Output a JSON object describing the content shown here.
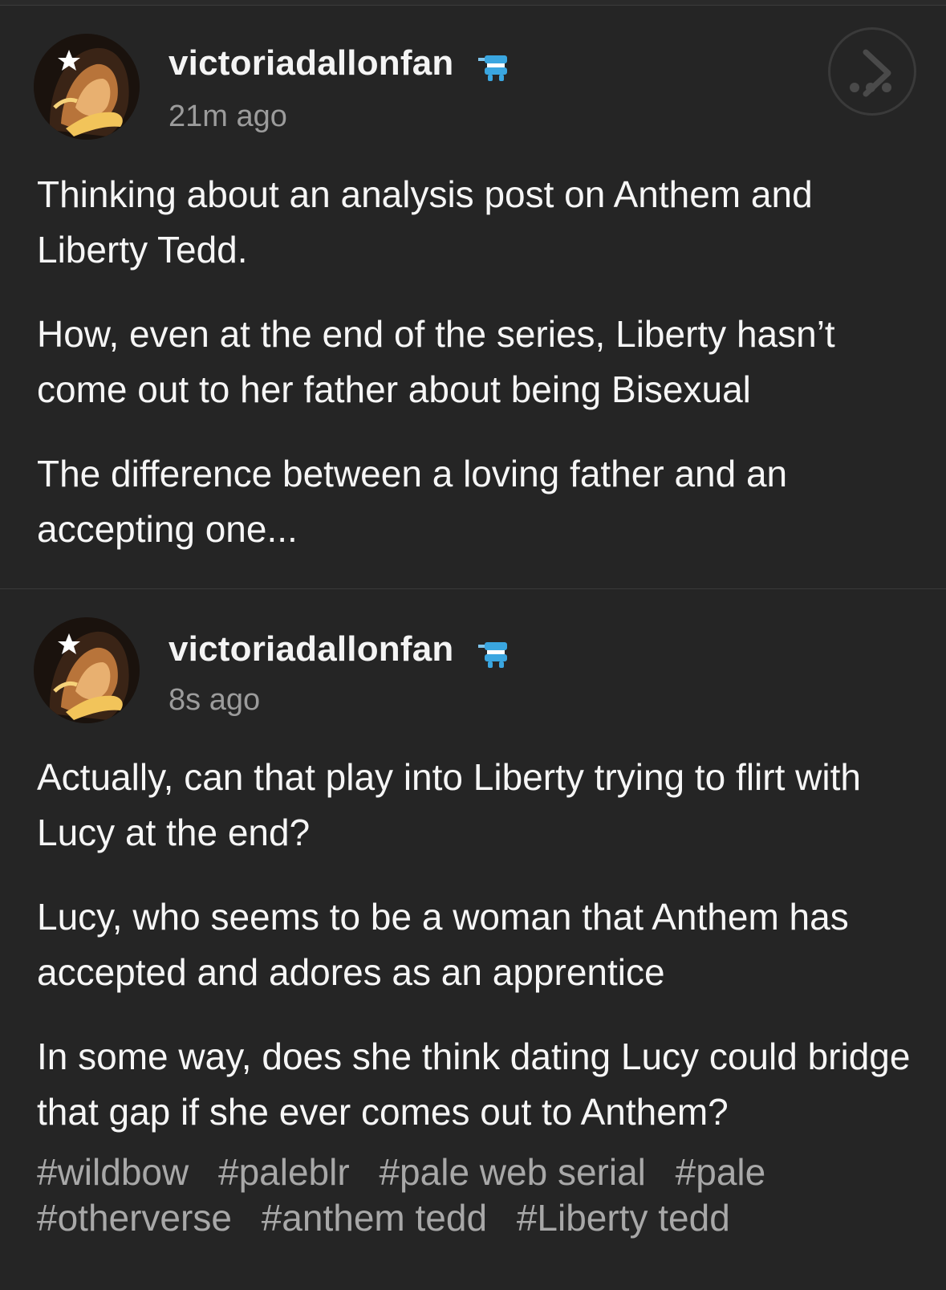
{
  "posts": [
    {
      "username": "victoriadallonfan",
      "timestamp": "21m ago",
      "paragraphs": [
        "Thinking about an analysis post on Anthem and Liberty Tedd.",
        "How, even at the end of the series, Liberty hasn’t come out to her father about being Bisexual",
        "The difference between a loving father and an accepting one..."
      ]
    },
    {
      "username": "victoriadallonfan",
      "timestamp": "8s ago",
      "paragraphs": [
        "Actually, can that play into Liberty trying to flirt with Lucy at the end?",
        "Lucy, who seems to be a woman that Anthem has accepted and adores as an apprentice",
        "In some way, does she think dating Lucy could bridge that gap if she ever comes out to Anthem?"
      ],
      "tags": [
        "#wildbow",
        "#paleblr",
        "#pale web serial",
        "#pale",
        "#otherverse",
        "#anthem tedd",
        "#Liberty tedd"
      ]
    }
  ],
  "icons": {
    "avatar": "hooded-figure-avatar",
    "badge": "wind-up-teeth-badge-icon",
    "share": "share-arrow-icon"
  },
  "colors": {
    "background": "#252525",
    "text": "#f6f6f6",
    "muted": "#9c9c9c",
    "badge": "#3aa6e0"
  }
}
